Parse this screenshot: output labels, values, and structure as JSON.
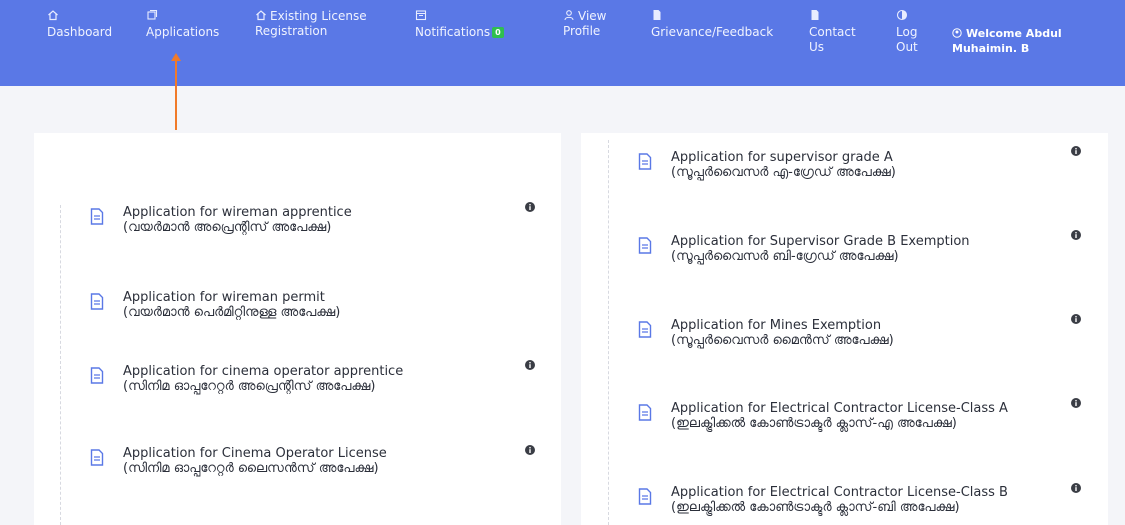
{
  "nav": {
    "dashboard": "Dashboard",
    "applications": "Applications",
    "existing_license_1": "Existing License",
    "existing_license_2": "Registration",
    "notifications": "Notifications",
    "notifications_count": "0",
    "view_profile_1": "View",
    "view_profile_2": "Profile",
    "grievance": "Grievance/Feedback",
    "contact_1": "Contact",
    "contact_2": "Us",
    "logout_1": "Log",
    "logout_2": "Out",
    "welcome_1": "Welcome Abdul",
    "welcome_2": "Muhaimin. B"
  },
  "left_apps": [
    {
      "title": "Application for wireman apprentice",
      "subtitle": "(വയർമാൻ അപ്രെന്റിസ് അപേക്ഷ)"
    },
    {
      "title": "Application for wireman permit",
      "subtitle": "(വയർമാൻ പെർമിറ്റിനുള്ള അപേക്ഷ)"
    },
    {
      "title": "Application for cinema operator apprentice",
      "subtitle": "(സിനിമ ഓപ്പറേറ്റർ അപ്രെന്റിസ് അപേക്ഷ)"
    },
    {
      "title": "Application for Cinema Operator License",
      "subtitle": "(സിനിമ ഓപ്പറേറ്റർ ലൈസൻസ് അപേക്ഷ)"
    }
  ],
  "right_apps": [
    {
      "title": "Application for supervisor grade A",
      "subtitle": "(സൂപ്പർവൈസർ എ-ഗ്രേഡ് അപേക്ഷ)"
    },
    {
      "title": "Application for Supervisor Grade B Exemption",
      "subtitle": "(സൂപ്പർവൈസർ ബി-ഗ്രേഡ് അപേക്ഷ)"
    },
    {
      "title": "Application for Mines Exemption",
      "subtitle": "(സൂപ്പർവൈസർ മൈൻസ് അപേക്ഷ)"
    },
    {
      "title": "Application for Electrical Contractor License-Class A",
      "subtitle": "(ഇലക്ട്രിക്കൽ കോൺട്രാക്ടർ ക്ലാസ്-എ അപേക്ഷ)"
    },
    {
      "title": "Application for Electrical Contractor License-Class B",
      "subtitle": "(ഇലക്ട്രിക്കൽ കോൺട്രാക്ടർ ക്ലാസ്-ബി അപേക്ഷ)"
    }
  ],
  "colors": {
    "navbar": "#5a78e6",
    "badge": "#2fbf4f",
    "arrow": "#f07a2a",
    "doc_icon": "#5a78e6"
  },
  "icons": {
    "dashboard": "home-icon",
    "applications": "copy-icon",
    "existing_license": "home-icon",
    "notifications": "calendar-icon",
    "view_profile": "user-icon",
    "grievance": "document-icon",
    "contact": "document-icon",
    "logout": "power-icon",
    "welcome": "user-circle-icon",
    "app_item": "document-icon",
    "app_info": "info-icon"
  }
}
